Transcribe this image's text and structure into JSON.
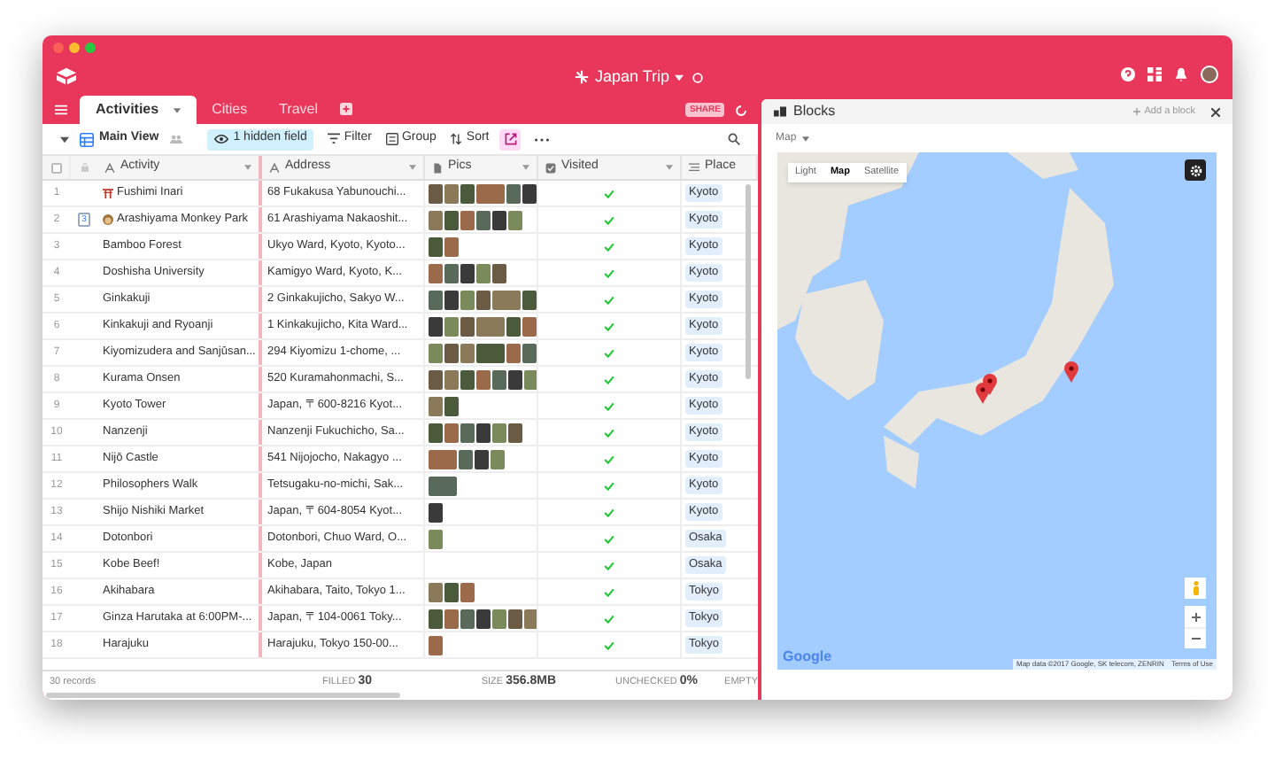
{
  "window": {
    "title": "Japan Trip"
  },
  "tabs": [
    {
      "label": "Activities",
      "selected": true
    },
    {
      "label": "Cities",
      "selected": false
    },
    {
      "label": "Travel",
      "selected": false
    }
  ],
  "share_label": "SHARE",
  "toolbar": {
    "view": "Main View",
    "hidden_fields": "1 hidden field",
    "buttons": [
      {
        "kind": "filter",
        "label": "Filter"
      },
      {
        "kind": "group",
        "label": "Group"
      },
      {
        "kind": "sort",
        "label": "Sort"
      }
    ]
  },
  "table": {
    "all_selected": false,
    "columns": [
      {
        "kind": "text",
        "label": "Activity"
      },
      {
        "kind": "text",
        "label": "Address"
      },
      {
        "kind": "attachment",
        "label": "Pics"
      },
      {
        "kind": "check",
        "label": "Visited"
      },
      {
        "kind": "link",
        "label": "Place"
      }
    ],
    "rows": [
      {
        "number": "1",
        "kind": "torii",
        "activity": "Fushimi Inari",
        "address": "68 Fukakusa Yabunouchi...",
        "pics": [
          {
            "kind": "photo"
          },
          {
            "kind": "photo"
          },
          {
            "kind": "photo"
          },
          {
            "kind": "wide"
          },
          {
            "kind": "photo"
          },
          {
            "kind": "photo"
          }
        ],
        "visited": true,
        "place": "Kyoto"
      },
      {
        "number": "2",
        "comments": "3",
        "kind": "monkey",
        "activity": "Arashiyama Monkey Park",
        "address": "61 Arashiyama Nakaoshit...",
        "pics": [
          {
            "kind": "photo"
          },
          {
            "kind": "photo"
          },
          {
            "kind": "photo"
          },
          {
            "kind": "photo"
          },
          {
            "kind": "photo"
          },
          {
            "kind": "photo"
          }
        ],
        "visited": true,
        "place": "Kyoto"
      },
      {
        "number": "3",
        "activity": "Bamboo Forest",
        "address": "Ukyo Ward, Kyoto, Kyoto...",
        "pics": [
          {
            "kind": "photo"
          },
          {
            "kind": "photo"
          }
        ],
        "visited": true,
        "place": "Kyoto"
      },
      {
        "number": "4",
        "activity": "Doshisha University",
        "address": "Kamigyo Ward, Kyoto, K...",
        "pics": [
          {
            "kind": "photo"
          },
          {
            "kind": "photo"
          },
          {
            "kind": "photo"
          },
          {
            "kind": "photo"
          },
          {
            "kind": "photo"
          }
        ],
        "visited": true,
        "place": "Kyoto"
      },
      {
        "number": "5",
        "activity": "Ginkakuji",
        "address": "2 Ginkakujicho, Sakyo W...",
        "pics": [
          {
            "kind": "photo"
          },
          {
            "kind": "photo"
          },
          {
            "kind": "photo"
          },
          {
            "kind": "photo"
          },
          {
            "kind": "wide"
          },
          {
            "kind": "photo"
          }
        ],
        "visited": true,
        "place": "Kyoto"
      },
      {
        "number": "6",
        "activity": "Kinkakuji and Ryoanji",
        "address": "1 Kinkakujicho, Kita Ward...",
        "pics": [
          {
            "kind": "photo"
          },
          {
            "kind": "photo"
          },
          {
            "kind": "photo"
          },
          {
            "kind": "wide"
          },
          {
            "kind": "photo"
          },
          {
            "kind": "photo"
          }
        ],
        "visited": true,
        "place": "Kyoto"
      },
      {
        "number": "7",
        "activity": "Kiyomizudera and Sanjūsan...",
        "address": "294 Kiyomizu 1-chome, ...",
        "pics": [
          {
            "kind": "photo"
          },
          {
            "kind": "photo"
          },
          {
            "kind": "photo"
          },
          {
            "kind": "wide"
          },
          {
            "kind": "photo"
          },
          {
            "kind": "photo"
          }
        ],
        "visited": true,
        "place": "Kyoto"
      },
      {
        "number": "8",
        "activity": "Kurama Onsen",
        "address": "520 Kuramahonmachi, S...",
        "pics": [
          {
            "kind": "photo"
          },
          {
            "kind": "photo"
          },
          {
            "kind": "photo"
          },
          {
            "kind": "photo"
          },
          {
            "kind": "photo"
          },
          {
            "kind": "photo"
          },
          {
            "kind": "photo"
          }
        ],
        "visited": true,
        "place": "Kyoto"
      },
      {
        "number": "9",
        "activity": "Kyoto Tower",
        "address": "Japan, 〒600-8216 Kyot...",
        "pics": [
          {
            "kind": "photo"
          },
          {
            "kind": "photo"
          }
        ],
        "visited": true,
        "place": "Kyoto"
      },
      {
        "number": "10",
        "activity": "Nanzenji",
        "address": "Nanzenji Fukuchicho, Sa...",
        "pics": [
          {
            "kind": "photo"
          },
          {
            "kind": "photo"
          },
          {
            "kind": "photo"
          },
          {
            "kind": "photo"
          },
          {
            "kind": "photo"
          },
          {
            "kind": "photo"
          }
        ],
        "visited": true,
        "place": "Kyoto"
      },
      {
        "number": "11",
        "activity": "Nijō Castle",
        "address": "541 Nijojocho, Nakagyo ...",
        "pics": [
          {
            "kind": "wide"
          },
          {
            "kind": "photo"
          },
          {
            "kind": "photo"
          },
          {
            "kind": "photo"
          }
        ],
        "visited": true,
        "place": "Kyoto"
      },
      {
        "number": "12",
        "activity": "Philosophers Walk",
        "address": "Tetsugaku-no-michi, Sak...",
        "pics": [
          {
            "kind": "wide"
          }
        ],
        "visited": true,
        "place": "Kyoto"
      },
      {
        "number": "13",
        "activity": "Shijo Nishiki Market",
        "address": "Japan, 〒604-8054 Kyot...",
        "pics": [
          {
            "kind": "photo"
          }
        ],
        "visited": true,
        "place": "Kyoto"
      },
      {
        "number": "14",
        "activity": "Dotonbori",
        "address": "Dotonbori, Chuo Ward, O...",
        "pics": [
          {
            "kind": "photo"
          }
        ],
        "visited": true,
        "place": "Osaka"
      },
      {
        "number": "15",
        "activity": "Kobe Beef!",
        "address": "Kobe, Japan",
        "visited": true,
        "place": "Osaka"
      },
      {
        "number": "16",
        "activity": "Akihabara",
        "address": "Akihabara, Taito, Tokyo 1...",
        "pics": [
          {
            "kind": "photo"
          },
          {
            "kind": "photo"
          },
          {
            "kind": "photo"
          }
        ],
        "visited": true,
        "place": "Tokyo"
      },
      {
        "number": "17",
        "activity": "Ginza Harutaka at 6:00PM-...",
        "address": "Japan, 〒104-0061 Toky...",
        "pics": [
          {
            "kind": "photo"
          },
          {
            "kind": "photo"
          },
          {
            "kind": "photo"
          },
          {
            "kind": "photo"
          },
          {
            "kind": "photo"
          },
          {
            "kind": "photo"
          },
          {
            "kind": "photo"
          }
        ],
        "visited": true,
        "place": "Tokyo"
      },
      {
        "number": "18",
        "activity": "Harajuku",
        "address": "Harajuku, Tokyo 150-00...",
        "pics": [
          {
            "kind": "photo"
          }
        ],
        "visited": true,
        "place": "Tokyo"
      }
    ]
  },
  "summary": [
    {
      "label": "30 records"
    },
    {
      "label": "FILLED",
      "value": "30"
    },
    {
      "label": "SIZE",
      "value": "356.8MB"
    },
    {
      "label": "UNCHECKED",
      "value": "0%"
    },
    {
      "label": "EMPTY"
    }
  ],
  "blocks": {
    "title": "Blocks",
    "add": "Add a block",
    "block_name": "Map",
    "map": {
      "types": [
        {
          "label": "Light",
          "selected": false
        },
        {
          "label": "Map",
          "selected": true
        },
        {
          "label": "Satellite",
          "selected": false
        }
      ],
      "logo": "Google",
      "attribution": "Map data ©2017 Google, SK telecom, ZENRIN",
      "terms": "Terms of Use"
    }
  }
}
